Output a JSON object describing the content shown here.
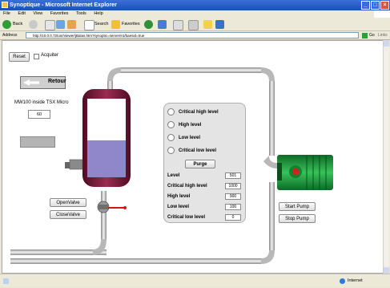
{
  "window": {
    "title": "Synoptique - Microsoft Internet Explorer",
    "controls": {
      "minimize": "_",
      "maximize": "□",
      "close": "×"
    }
  },
  "menu": [
    "File",
    "Edit",
    "View",
    "Favorites",
    "Tools",
    "Help"
  ],
  "toolbar": {
    "back": "Back",
    "search": "Search",
    "favorites": "Favorites"
  },
  "address": {
    "label": "Address",
    "url": "http://10.0.0.72/usr/viewer/jBalas.htm?synoptic=server/e1/baesid=true",
    "go": "Go",
    "links": "Links"
  },
  "page": {
    "reset_label": "Reset",
    "acquit_label": "Acquiter",
    "retour_label": "Retour",
    "mw_label": "MW100 inside TSX Micro",
    "mw_value": "60",
    "open_valve": "OpenValve",
    "close_valve": "CloseValve",
    "start_pump": "Start Pump",
    "stop_pump": "Stop Pump",
    "purge": "Purge",
    "alarms": [
      {
        "label": "Critical high level"
      },
      {
        "label": "High level"
      },
      {
        "label": "Low level"
      },
      {
        "label": "Critical low level"
      }
    ],
    "values": [
      {
        "label": "Level",
        "value": "501"
      },
      {
        "label": "Critical high level",
        "value": "1000"
      },
      {
        "label": "High level",
        "value": "900"
      },
      {
        "label": "Low level",
        "value": "100"
      },
      {
        "label": "Critical low level",
        "value": "0"
      }
    ],
    "tank_fill": 0.47
  },
  "status": {
    "zone": "Internet"
  },
  "colors": {
    "tank_body": "#7a1a3a",
    "liquid": "#8f87c9",
    "pump": "#1f9e3e",
    "pump_indicator": "#e01b1b",
    "pipe": "#d4d4d4"
  }
}
